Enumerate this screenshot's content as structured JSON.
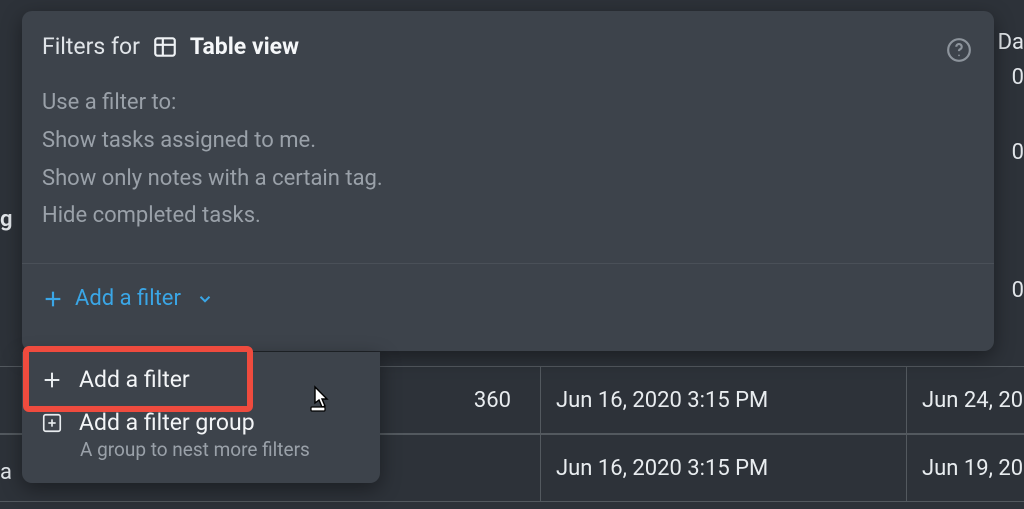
{
  "panel": {
    "title_prefix": "Filters for",
    "title_view": "Table view",
    "desc": {
      "line1": "Use a filter to:",
      "line2": "Show tasks assigned to me.",
      "line3": "Show only notes with a certain tag.",
      "line4": "Hide completed tasks."
    },
    "action_label": "Add a filter"
  },
  "dropdown": {
    "item1_label": "Add a filter",
    "item2_label": "Add a filter group",
    "item2_sub": "A group to nest more filters"
  },
  "bg": {
    "label_g": "g",
    "label_a": "a",
    "label_d_partial": "Da",
    "zero": "0",
    "row1_num": "360",
    "row1_date": "Jun 16, 2020 3:15 PM",
    "row1_date2": "Jun 24, 20",
    "row2_date": "Jun 16, 2020 3:15 PM",
    "row2_date2": "Jun 19, 20"
  }
}
